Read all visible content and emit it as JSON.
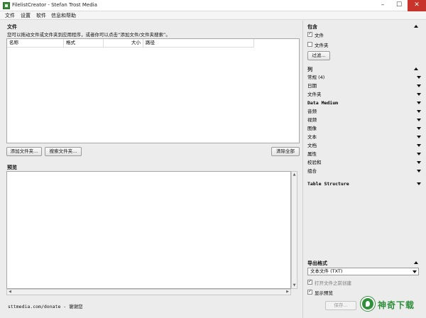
{
  "window": {
    "title": "FilelistCreator - Stefan Trost Media"
  },
  "menu": [
    "文件",
    "设置",
    "软件",
    "信息和帮助"
  ],
  "files": {
    "heading": "文件",
    "hint": "您可以拖动文件或文件夹到应用程序，或者你可以点击“添加文件/文件夹搜索”。",
    "columns": [
      "名称",
      "格式",
      "大小",
      "路径"
    ],
    "add_folder_button": "添加文件夹...",
    "search_button": "搜索文件夹...",
    "clear_button": "清除全部"
  },
  "preview": {
    "heading": "预览"
  },
  "footer": {
    "text": "sttmedia.com/donate - 谢谢您"
  },
  "include": {
    "heading": "包含",
    "files_label": "文件",
    "files_checked": true,
    "folders_label": "文件夹",
    "folders_checked": false,
    "filter_button": "过滤..."
  },
  "columns_panel": {
    "heading": "列",
    "items": [
      "常规 (4)",
      "日期",
      "文件夹",
      "Data Medium",
      "音频",
      "视频",
      "图像",
      "文本",
      "文档",
      "属性",
      "校验和",
      "组合"
    ],
    "table_structure": "Table Structure"
  },
  "export": {
    "heading": "导出格式",
    "format_value": "文本文件 (TXT)",
    "open_after_label": "打开文件之前创建",
    "open_after_checked": true,
    "show_preview_label": "显示预览",
    "show_preview_checked": true,
    "save_button": "保存..."
  },
  "watermark": {
    "text": "神奇下载"
  },
  "colors": {
    "accent_green": "#2f8f3a",
    "close_red": "#c8332b"
  },
  "icons": {
    "app": "filelist-app-icon",
    "dropdown": "triangle-down-icon",
    "collapse": "triangle-up-icon"
  }
}
